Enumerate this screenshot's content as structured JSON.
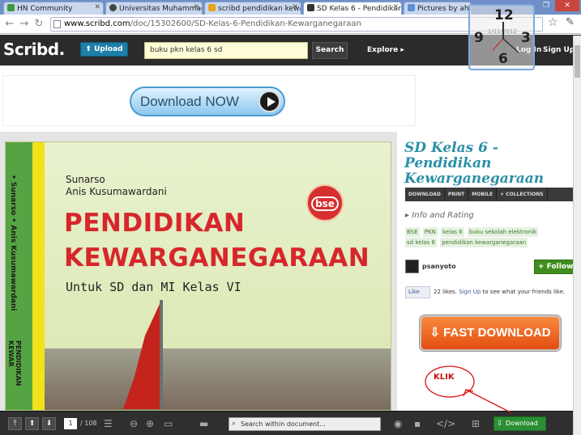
{
  "browser": {
    "tabs": [
      {
        "label": "HN Community",
        "color": "#3c9a3c",
        "active": false
      },
      {
        "label": "Universitas Muhammadiya",
        "color": "#444444",
        "active": false
      },
      {
        "label": "scribd pendidikan kewarga",
        "color": "#e6a21a",
        "active": false
      },
      {
        "label": "SD Kelas 6 - Pendidikan Ke",
        "color": "#333333",
        "active": true
      },
      {
        "label": "Pictures by ahuy_ir",
        "color": "#5a8fd8",
        "active": false
      }
    ],
    "url_domain": "www.scribd.com",
    "url_path": "/doc/15302600/SD-Kelas-6-Pendidikan-Kewarganegaraan"
  },
  "clock": {
    "n12": "12",
    "n3": "3",
    "n6": "6",
    "n9": "9",
    "date": "1/11/2012"
  },
  "header": {
    "logo": "Scribd.",
    "upload_label": "Upload",
    "search_value": "buku pkn kelas 6 sd",
    "search_label": "Search",
    "explore_label": "Explore ▸",
    "login_label": "Log In",
    "signup_label": "Sign Up"
  },
  "ad": {
    "download_now": "Download NOW"
  },
  "cover": {
    "author1": "Sunarso",
    "author2": "Anis Kusumawardani",
    "title_line1": "PENDIDIKAN",
    "title_line2": "KEWARGANEGARAAN",
    "subtitle": "Untuk SD dan MI Kelas VI",
    "bse": "bse",
    "spine_top": "• Sunarso  • Anis Kusumawardani",
    "spine_bottom": "PENDIDIKAN KEWAR"
  },
  "toolbar": {
    "page_current": "1",
    "page_total": "/ 108",
    "search_placeholder": "Search within document...",
    "download_label": "Download"
  },
  "sidebar": {
    "title": "SD Kelas 6 - Pendidikan Kewarganegaraan",
    "actions": [
      "DOWNLOAD",
      "PRINT",
      "MOBILE",
      "+ COLLECTIONS"
    ],
    "info_label": "▸ Info and Rating",
    "tags": [
      "BSE",
      "PKN",
      "kelas 6",
      "buku sekolah elektronik",
      "sd kelas 6",
      "pendidikan kewarganegaraan"
    ],
    "uploader": "psanyoto",
    "follow_label": "+ Follow",
    "like_label": "Like",
    "like_count": "22 likes.",
    "like_signup": "Sign Up",
    "like_suffix": "to see what your friends like.",
    "fast_download": "⇩ FAST DOWNLOAD",
    "klik": "KLIK"
  },
  "colors": {
    "accent": "#2d8fa7",
    "brand_bar": "#2b2b2b",
    "title_red": "#d7262b",
    "download_green": "#2a8f33"
  }
}
